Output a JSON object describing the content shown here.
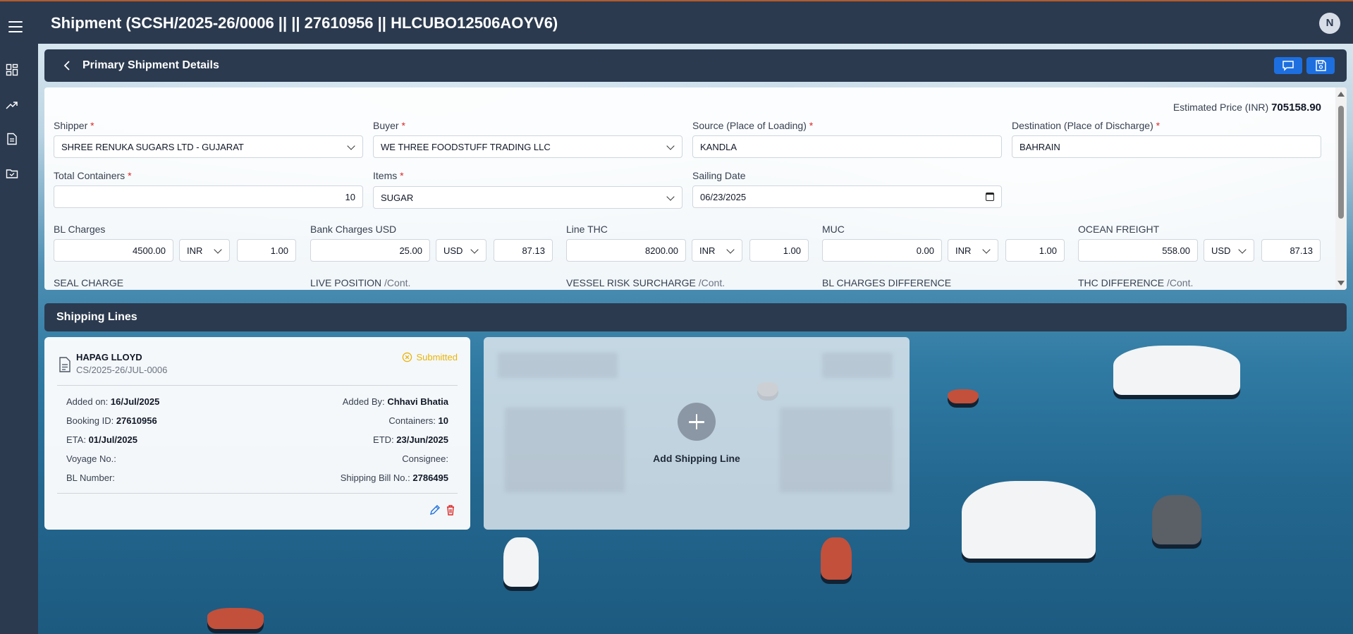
{
  "header": {
    "title": "Shipment (SCSH/2025-26/0006 || || 27610956 || HLCUBO12506AOYV6)",
    "avatar_initial": "N"
  },
  "sidebar": {
    "icons": [
      "dashboard-icon",
      "trending-icon",
      "document-icon",
      "folder-icon"
    ]
  },
  "primary": {
    "title": "Primary Shipment Details",
    "estimated_price_label": "Estimated Price (INR)",
    "estimated_price_value": "705158.90",
    "required_mark": "*",
    "fields": {
      "shipper": {
        "label": "Shipper",
        "value": "SHREE RENUKA SUGARS LTD - GUJARAT"
      },
      "buyer": {
        "label": "Buyer",
        "value": "WE THREE FOODSTUFF TRADING LLC"
      },
      "source": {
        "label": "Source (Place of Loading)",
        "value": "KANDLA"
      },
      "destination": {
        "label": "Destination (Place of Discharge)",
        "value": "BAHRAIN"
      },
      "total_containers": {
        "label": "Total Containers",
        "value": "10"
      },
      "items": {
        "label": "Items",
        "value": "SUGAR"
      },
      "sailing_date": {
        "label": "Sailing Date",
        "value": "06/23/2025"
      }
    },
    "charges": [
      {
        "label": "BL Charges",
        "unit": "",
        "amount": "4500.00",
        "currency": "INR",
        "rate": "1.00"
      },
      {
        "label": "Bank Charges USD",
        "unit": "",
        "amount": "25.00",
        "currency": "USD",
        "rate": "87.13"
      },
      {
        "label": "Line THC",
        "unit": "",
        "amount": "8200.00",
        "currency": "INR",
        "rate": "1.00"
      },
      {
        "label": "MUC",
        "unit": "",
        "amount": "0.00",
        "currency": "INR",
        "rate": "1.00"
      },
      {
        "label": "OCEAN FREIGHT",
        "unit": "",
        "amount": "558.00",
        "currency": "USD",
        "rate": "87.13"
      }
    ],
    "more_labels": [
      {
        "label": "SEAL CHARGE",
        "unit": ""
      },
      {
        "label": "LIVE POSITION",
        "unit": "/Cont."
      },
      {
        "label": "VESSEL RISK SURCHARGE",
        "unit": "/Cont."
      },
      {
        "label": "BL CHARGES DIFFERENCE",
        "unit": ""
      },
      {
        "label": "THC DIFFERENCE",
        "unit": "/Cont."
      }
    ]
  },
  "shipping_lines": {
    "title": "Shipping Lines",
    "card": {
      "name": "HAPAG LLOYD",
      "code": "CS/2025-26/JUL-0006",
      "status": "Submitted",
      "added_on_label": "Added on:",
      "added_on": "16/Jul/2025",
      "added_by_label": "Added By:",
      "added_by": "Chhavi Bhatia",
      "booking_id_label": "Booking ID:",
      "booking_id": "27610956",
      "containers_label": "Containers:",
      "containers": "10",
      "eta_label": "ETA:",
      "eta": "01/Jul/2025",
      "etd_label": "ETD:",
      "etd": "23/Jun/2025",
      "voyage_label": "Voyage No.:",
      "voyage": "",
      "consignee_label": "Consignee:",
      "consignee": "",
      "bl_number_label": "BL Number:",
      "bl_number": "",
      "shipping_bill_label": "Shipping Bill No.:",
      "shipping_bill": "2786495"
    },
    "add_label": "Add Shipping Line"
  },
  "colors": {
    "navy": "#2b3a4f",
    "accent": "#1d6fe0",
    "status": "#eab308",
    "delete": "#dc2626"
  }
}
